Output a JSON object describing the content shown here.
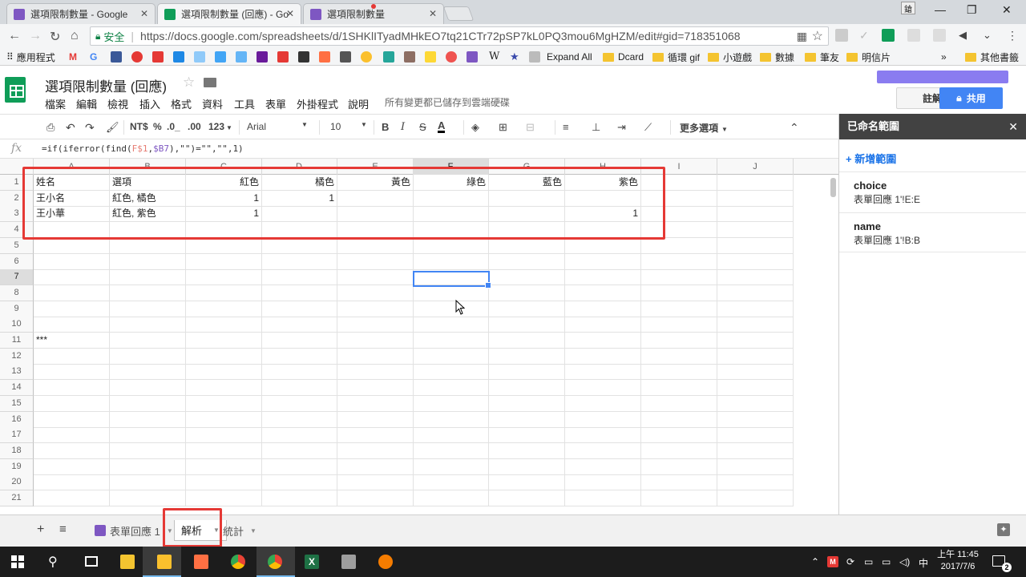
{
  "browser": {
    "tabs": [
      {
        "label": "選項限制數量 - Google",
        "active": false,
        "color": "#7e57c2"
      },
      {
        "label": "選項限制數量 (回應) - Go",
        "active": true,
        "color": "#0f9d58"
      },
      {
        "label": "選項限制數量",
        "active": false,
        "color": "#7e57c2"
      }
    ],
    "secure_label": "安全",
    "url": "https://docs.google.com/spreadsheets/d/1SHKlITyadMHkEO7tq21CTr72pSP7kL0PQ3mou6MgHZM/edit#gid=718351068",
    "bookmarks": [
      "應用程式",
      "Expand All",
      "Dcard",
      "循環 gif",
      "小遊戲",
      "數據",
      "筆友",
      "明信片"
    ],
    "bookmarks_overflow": "»",
    "other_bookmarks": "其他書籤"
  },
  "sheets": {
    "title": "選項限制數量 (回應)",
    "menus": [
      "檔案",
      "編輯",
      "檢視",
      "插入",
      "格式",
      "資料",
      "工具",
      "表單",
      "外掛程式",
      "說明"
    ],
    "save_status": "所有變更都已儲存到雲端硬碟",
    "comment_label": "註解",
    "share_label": "共用",
    "toolbar": {
      "currency": "NT$",
      "percent": "%",
      "dec_less": ".0_",
      "dec_more": ".00",
      "format": "123",
      "font": "Arial",
      "font_size": "10",
      "more": "更多選項"
    },
    "formula": "=if(iferror(find(F$1,$B7),\"\")=\"\",\"\",1)",
    "formula_parts": [
      "=if(iferror(find(",
      "F$1",
      ",",
      "$B7",
      "),\"\")=\"\",\"\",1)"
    ],
    "columns": [
      "A",
      "B",
      "C",
      "D",
      "E",
      "F",
      "G",
      "H",
      "I",
      "J"
    ],
    "selected_column": "F",
    "selected_row": 7,
    "rows": [
      [
        "姓名",
        "選項",
        "紅色",
        "橘色",
        "黃色",
        "綠色",
        "藍色",
        "紫色",
        "",
        ""
      ],
      [
        "王小名",
        "紅色, 橘色",
        "1",
        "1",
        "",
        "",
        "",
        "",
        "",
        ""
      ],
      [
        "王小華",
        "紅色, 紫色",
        "1",
        "",
        "",
        "",
        "",
        "1",
        "",
        ""
      ],
      [
        "",
        "",
        "",
        "",
        "",
        "",
        "",
        "",
        "",
        ""
      ],
      [
        "",
        "",
        "",
        "",
        "",
        "",
        "",
        "",
        "",
        ""
      ],
      [
        "",
        "",
        "",
        "",
        "",
        "",
        "",
        "",
        "",
        ""
      ],
      [
        "",
        "",
        "",
        "",
        "",
        "",
        "",
        "",
        "",
        ""
      ],
      [
        "",
        "",
        "",
        "",
        "",
        "",
        "",
        "",
        "",
        ""
      ],
      [
        "",
        "",
        "",
        "",
        "",
        "",
        "",
        "",
        "",
        ""
      ],
      [
        "",
        "",
        "",
        "",
        "",
        "",
        "",
        "",
        "",
        ""
      ],
      [
        "***",
        "",
        "",
        "",
        "",
        "",
        "",
        "",
        "",
        ""
      ],
      [
        "",
        "",
        "",
        "",
        "",
        "",
        "",
        "",
        "",
        ""
      ],
      [
        "",
        "",
        "",
        "",
        "",
        "",
        "",
        "",
        "",
        ""
      ],
      [
        "",
        "",
        "",
        "",
        "",
        "",
        "",
        "",
        "",
        ""
      ],
      [
        "",
        "",
        "",
        "",
        "",
        "",
        "",
        "",
        "",
        ""
      ],
      [
        "",
        "",
        "",
        "",
        "",
        "",
        "",
        "",
        "",
        ""
      ],
      [
        "",
        "",
        "",
        "",
        "",
        "",
        "",
        "",
        "",
        ""
      ],
      [
        "",
        "",
        "",
        "",
        "",
        "",
        "",
        "",
        "",
        ""
      ],
      [
        "",
        "",
        "",
        "",
        "",
        "",
        "",
        "",
        "",
        ""
      ],
      [
        "",
        "",
        "",
        "",
        "",
        "",
        "",
        "",
        "",
        ""
      ],
      [
        "",
        "",
        "",
        "",
        "",
        "",
        "",
        "",
        "",
        ""
      ]
    ],
    "numeric_columns": [
      2,
      3,
      4,
      5,
      6,
      7
    ],
    "sheet_tabs": [
      {
        "label": "表單回應 1",
        "active": false
      },
      {
        "label": "解析",
        "active": true
      },
      {
        "label": "統計",
        "active": false
      }
    ]
  },
  "panel": {
    "title": "已命名範圍",
    "add_label": "+ 新增範圍",
    "ranges": [
      {
        "name": "choice",
        "range": "表單回應 1'!E:E"
      },
      {
        "name": "name",
        "range": "表單回應 1'!B:B"
      }
    ]
  },
  "taskbar": {
    "time": "上午 11:45",
    "date": "2017/7/6",
    "ime": "中",
    "notifications": "2"
  },
  "colors": {
    "accent": "#4285f4",
    "highlight_box": "#e53935",
    "sheets_green": "#0f9d58"
  }
}
